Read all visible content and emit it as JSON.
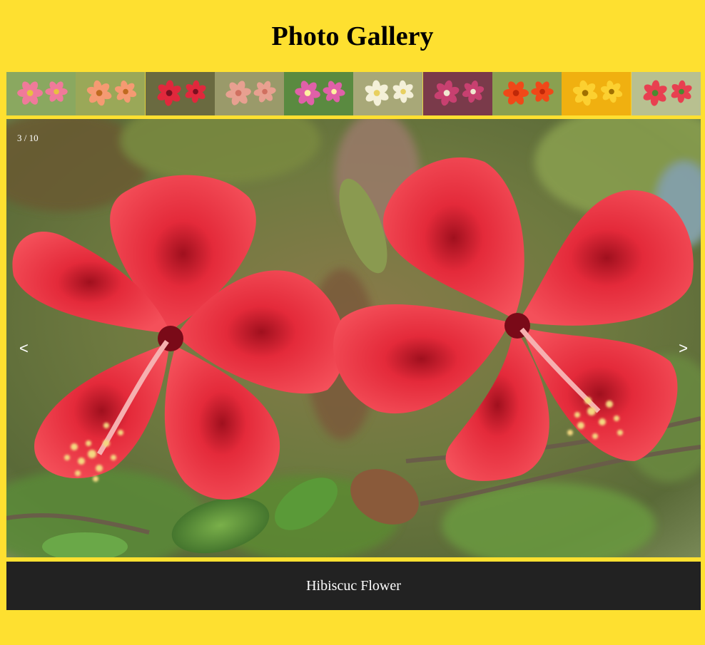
{
  "header": {
    "title": "Photo Gallery"
  },
  "thumbnails": [
    {
      "name": "pink-gerbera-thumb",
      "bg": "#8aa860",
      "petal": "#f07a9a",
      "center": "#e8c040"
    },
    {
      "name": "orange-gerbera-thumb",
      "bg": "#9aa858",
      "petal": "#f59a72",
      "center": "#c06a20"
    },
    {
      "name": "red-hibiscus-thumb",
      "bg": "#6a6a40",
      "petal": "#e0283c",
      "center": "#7a1020"
    },
    {
      "name": "lotus-thumb",
      "bg": "#9a9a6a",
      "petal": "#e8a090",
      "center": "#d07060"
    },
    {
      "name": "petunia-thumb",
      "bg": "#5a8a40",
      "petal": "#e060a8",
      "center": "#fff0a0"
    },
    {
      "name": "white-plumeria-thumb",
      "bg": "#a8a878",
      "petal": "#f4f0d8",
      "center": "#e8d060"
    },
    {
      "name": "chrysanthemum-thumb",
      "bg": "#7a3a4a",
      "petal": "#c84070",
      "center": "#f0e8d0"
    },
    {
      "name": "orange-rose-thumb",
      "bg": "#8aa050",
      "petal": "#f04818",
      "center": "#c02808"
    },
    {
      "name": "yellow-dahlia-thumb",
      "bg": "#f0b010",
      "petal": "#fcd030",
      "center": "#a07000"
    },
    {
      "name": "tulip-thumb",
      "bg": "#b8c090",
      "petal": "#e84050",
      "center": "#4a8a30"
    }
  ],
  "viewer": {
    "counter": "3 / 10",
    "prev_label": "<",
    "next_label": ">",
    "photo_icon": "red-hibiscus-photo"
  },
  "caption": {
    "text": "Hibiscuc Flower"
  },
  "colors": {
    "page_bg": "#fee030",
    "caption_bg": "#222222",
    "hibiscus_red": "#e62a3a"
  }
}
